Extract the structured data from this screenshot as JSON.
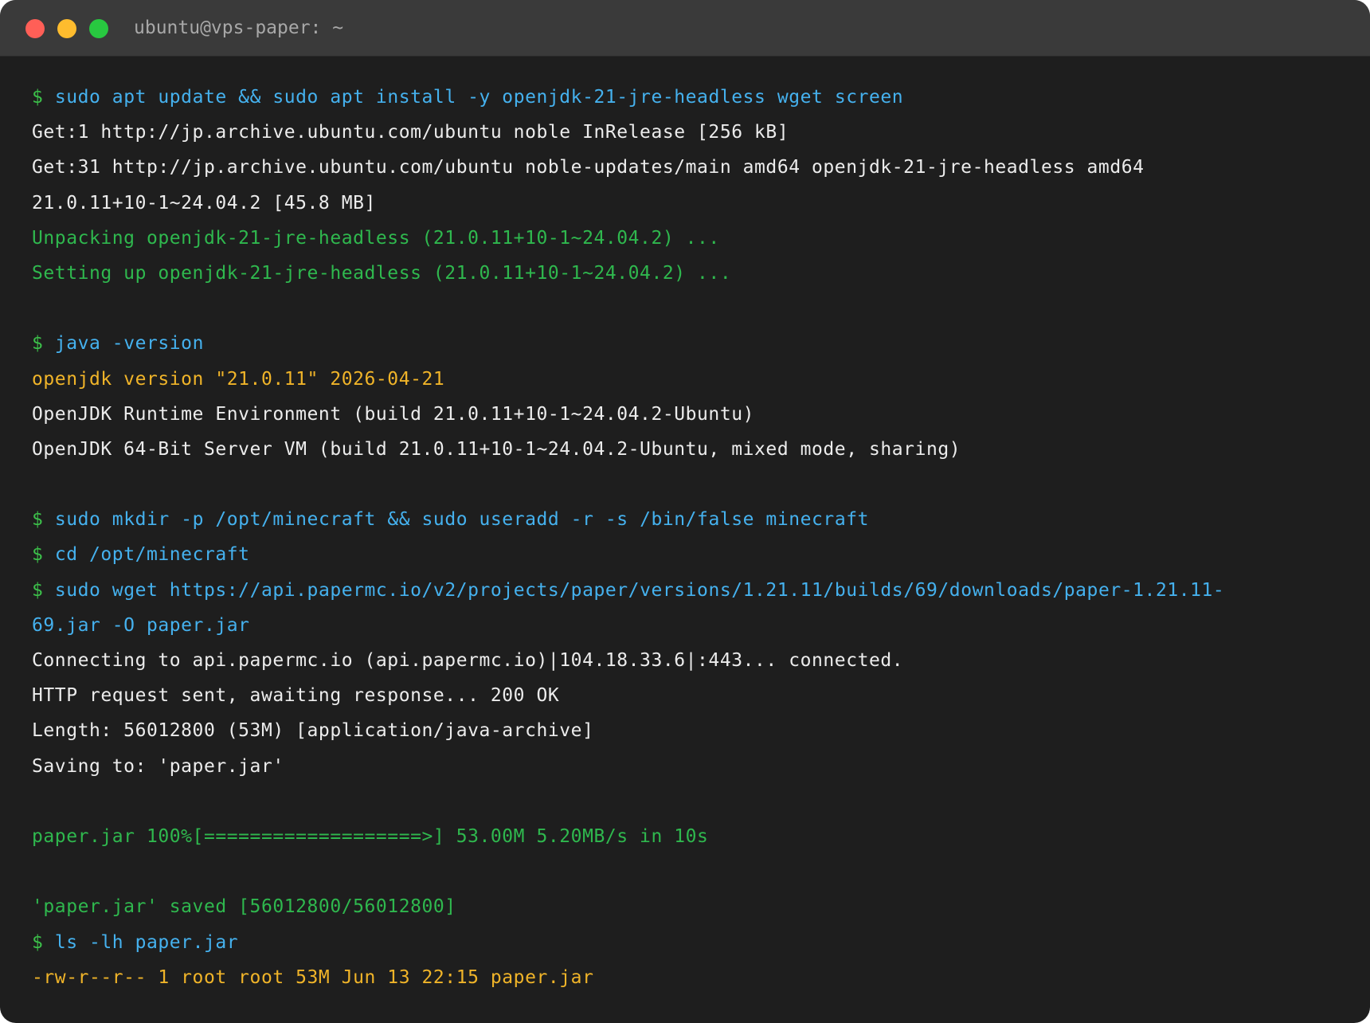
{
  "window": {
    "title": "ubuntu@vps-paper: ~",
    "colors": {
      "background": "#1e1e1e",
      "titlebar": "#3a3a3a",
      "close": "#ff5f57",
      "minimize": "#febc2e",
      "maximize": "#28c840",
      "prompt": "#3cc04a",
      "command": "#45b1ee",
      "output": "#ececec",
      "success": "#2fb84e",
      "highlight": "#f0b429"
    }
  },
  "terminal": {
    "prompt": "$",
    "lines": [
      {
        "type": "cmd",
        "text": "sudo apt update && sudo apt install -y openjdk-21-jre-headless wget screen"
      },
      {
        "type": "out",
        "text": "Get:1 http://jp.archive.ubuntu.com/ubuntu noble InRelease [256 kB]"
      },
      {
        "type": "out",
        "text": "Get:31 http://jp.archive.ubuntu.com/ubuntu noble-updates/main amd64 openjdk-21-jre-headless amd64"
      },
      {
        "type": "out",
        "text": "21.0.11+10-1~24.04.2 [45.8 MB]"
      },
      {
        "type": "ok",
        "text": "Unpacking openjdk-21-jre-headless (21.0.11+10-1~24.04.2) ..."
      },
      {
        "type": "ok",
        "text": "Setting up openjdk-21-jre-headless (21.0.11+10-1~24.04.2) ..."
      },
      {
        "type": "blank",
        "text": ""
      },
      {
        "type": "cmd",
        "text": "java -version"
      },
      {
        "type": "warn",
        "text": "openjdk version \"21.0.11\" 2026-04-21"
      },
      {
        "type": "out",
        "text": "OpenJDK Runtime Environment (build 21.0.11+10-1~24.04.2-Ubuntu)"
      },
      {
        "type": "out",
        "text": "OpenJDK 64-Bit Server VM (build 21.0.11+10-1~24.04.2-Ubuntu, mixed mode, sharing)"
      },
      {
        "type": "blank",
        "text": ""
      },
      {
        "type": "cmd",
        "text": "sudo mkdir -p /opt/minecraft && sudo useradd -r -s /bin/false minecraft"
      },
      {
        "type": "cmd",
        "text": "cd /opt/minecraft"
      },
      {
        "type": "cmd",
        "text": "sudo wget https://api.papermc.io/v2/projects/paper/versions/1.21.11/builds/69/downloads/paper-1.21.11-"
      },
      {
        "type": "cmdcont",
        "text": "69.jar -O paper.jar"
      },
      {
        "type": "out",
        "text": "Connecting to api.papermc.io (api.papermc.io)|104.18.33.6|:443... connected."
      },
      {
        "type": "out",
        "text": "HTTP request sent, awaiting response... 200 OK"
      },
      {
        "type": "out",
        "text": "Length: 56012800 (53M) [application/java-archive]"
      },
      {
        "type": "out",
        "text": "Saving to: 'paper.jar'"
      },
      {
        "type": "blank",
        "text": ""
      },
      {
        "type": "ok",
        "text": "paper.jar 100%[===================>] 53.00M 5.20MB/s in 10s"
      },
      {
        "type": "blank",
        "text": ""
      },
      {
        "type": "ok",
        "text": "'paper.jar' saved [56012800/56012800]"
      },
      {
        "type": "cmd",
        "text": "ls -lh paper.jar"
      },
      {
        "type": "warn",
        "text": "-rw-r--r-- 1 root root 53M Jun 13 22:15 paper.jar"
      }
    ]
  }
}
